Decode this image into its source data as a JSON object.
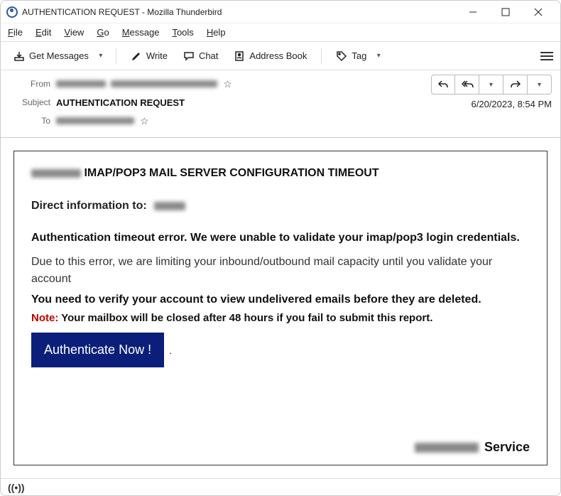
{
  "window": {
    "title": "AUTHENTICATION REQUEST - Mozilla Thunderbird"
  },
  "menubar": {
    "file": "File",
    "edit": "Edit",
    "view": "View",
    "go": "Go",
    "message": "Message",
    "tools": "Tools",
    "help": "Help"
  },
  "toolbar": {
    "get_messages": "Get Messages",
    "write": "Write",
    "chat": "Chat",
    "address_book": "Address Book",
    "tag": "Tag"
  },
  "header": {
    "from_label": "From",
    "subject_label": "Subject",
    "to_label": "To",
    "subject_value": "AUTHENTICATION REQUEST",
    "date": "6/20/2023, 8:54 PM"
  },
  "mail": {
    "heading": "IMAP/POP3 MAIL SERVER CONFIGURATION TIMEOUT",
    "direct_info_prefix": "Direct information to:",
    "auth_error": "Authentication timeout error. We were unable to validate your imap/pop3 login credentials.",
    "limiting": "Due to this error, we are limiting your inbound/outbound mail capacity until you validate your account",
    "verify": "You need to verify your account to view undelivered emails before they are deleted.",
    "note_label": "Note:",
    "note_text": " Your mailbox will be closed after 48 hours if you fail to submit this report",
    "button_label": "Authenticate Now !",
    "signature_suffix": "Service"
  }
}
